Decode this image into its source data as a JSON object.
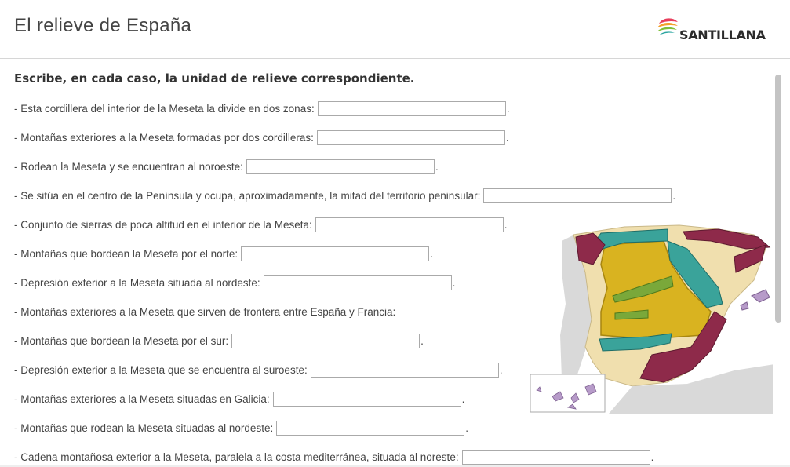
{
  "header": {
    "title": "El relieve de España",
    "logo_text": "SANTILLANA"
  },
  "instructions": "Escribe, en cada caso, la unidad de relieve correspondiente.",
  "questions": [
    {
      "text": "- Esta cordillera del interior de la Meseta la divide en dos zonas:",
      "value": ""
    },
    {
      "text": "- Montañas exteriores a la Meseta formadas por dos cordilleras:",
      "value": ""
    },
    {
      "text": "- Rodean la Meseta y se encuentran al noroeste:",
      "value": ""
    },
    {
      "text": "- Se sitúa en el centro de la Península y ocupa, aproximadamente, la mitad del territorio peninsular:",
      "value": ""
    },
    {
      "text": "- Conjunto de sierras de poca altitud en el interior de la Meseta:",
      "value": ""
    },
    {
      "text": "- Montañas que bordean la Meseta por el norte:",
      "value": ""
    },
    {
      "text": "- Depresión exterior a la Meseta situada al nordeste:",
      "value": ""
    },
    {
      "text": "- Montañas exteriores a la Meseta que sirven de frontera entre España y Francia:",
      "value": ""
    },
    {
      "text": "- Montañas que bordean la Meseta por el sur:",
      "value": ""
    },
    {
      "text": "- Depresión exterior a la Meseta que se encuentra al suroeste:",
      "value": ""
    },
    {
      "text": "- Montañas exteriores a la Meseta situadas en Galicia:",
      "value": ""
    },
    {
      "text": "- Montañas que rodean la Meseta situadas al nordeste:",
      "value": ""
    },
    {
      "text": "- Cadena montañosa exterior a la Meseta, paralela a la costa mediterránea, situada al noreste:",
      "value": ""
    }
  ],
  "period": ".",
  "colors": {
    "meseta": "#d9b320",
    "teal_mountains": "#3aa39a",
    "maroon_mountains": "#8e2a4a",
    "green_mountains": "#7aa83a",
    "land": "#f0dfae",
    "portugal": "#d9d9d9"
  }
}
